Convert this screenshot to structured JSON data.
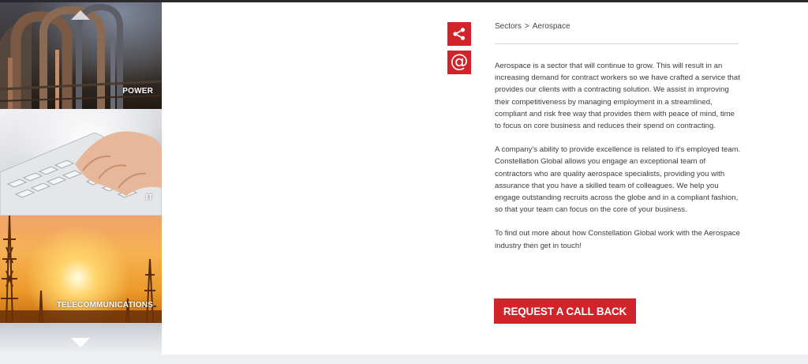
{
  "sidebar": {
    "sectors": [
      {
        "label": "POWER"
      },
      {
        "label": "IT"
      },
      {
        "label": "TELECOMMUNICATIONS"
      }
    ]
  },
  "breadcrumb": {
    "items": [
      "Sectors",
      "Aerospace"
    ],
    "separator": ">"
  },
  "share": {
    "share_icon": "share-icon",
    "email_icon": "at-sign-icon",
    "email_glyph": "@"
  },
  "content": {
    "paragraphs": [
      "Aerospace is a sector that will continue to grow.  This will result in an increasing demand for contract workers so we have crafted a service that provides our clients with a contracting solution. We assist in improving their competitiveness by managing employment in a streamlined, compliant and risk free way that provides them with peace of mind, time to focus on core business and reduces their spend on contracting.",
      "A company's ability to provide excellence is related to it's employed team. Constellation Global allows you engage an exceptional team of contractors who are quality aerospace specialists,  providing you with assurance that you have a skilled team of colleagues.  We help you engage outstanding recruits across the globe and in a compliant fashion, so that your team can focus on the core of your business.",
      "To find out more about how Constellation Global work with the Aerospace industry then get in touch!"
    ]
  },
  "cta": {
    "label": "REQUEST A CALL BACK"
  },
  "colors": {
    "accent": "#d2232a",
    "text": "#3c3c3c",
    "background": "#ffffff"
  }
}
